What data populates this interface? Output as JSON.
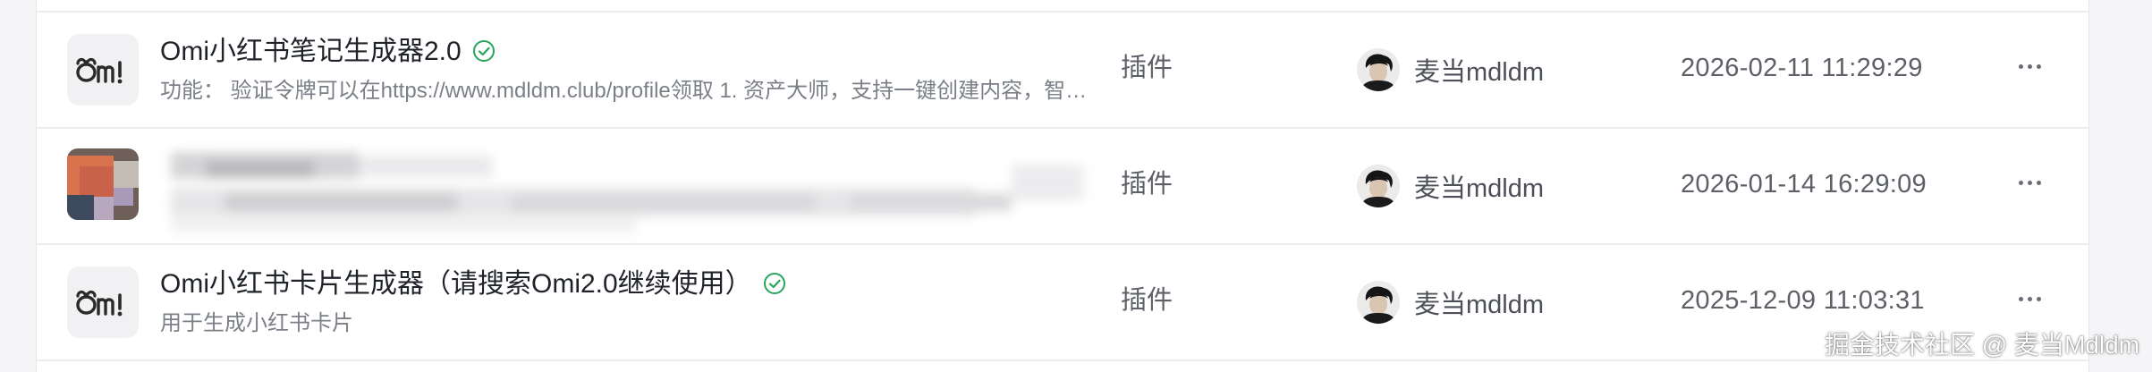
{
  "rows": [
    {
      "title": "Omi小红书笔记生成器2.0",
      "description": "功能： 验证令牌可以在https://www.mdldm.club/profile领取 1. 资产大师，支持一键创建内容，智能生成笔记标题与正文",
      "type": "插件",
      "author": "麦当mdldm",
      "date": "2026-02-11 11:29:29",
      "logo_icon": "omi-logo-icon",
      "verified_icon": "check-circle-icon"
    },
    {
      "title": "",
      "description": "",
      "type": "插件",
      "author": "麦当mdldm",
      "date": "2026-01-14 16:29:09",
      "logo_icon": "mosaic-logo-icon",
      "verified_icon": "check-circle-icon"
    },
    {
      "title": "Omi小红书卡片生成器（请搜索Omi2.0继续使用）",
      "description": "用于生成小红书卡片",
      "type": "插件",
      "author": "麦当mdldm",
      "date": "2025-12-09 11:03:31",
      "logo_icon": "omi-logo-icon",
      "verified_icon": "check-circle-icon"
    }
  ],
  "watermark": "掘金技术社区 @ 麦当Mdldm",
  "colors": {
    "verified": "#26a65b",
    "text_primary": "#1f2329",
    "text_secondary": "#7b7f87"
  }
}
